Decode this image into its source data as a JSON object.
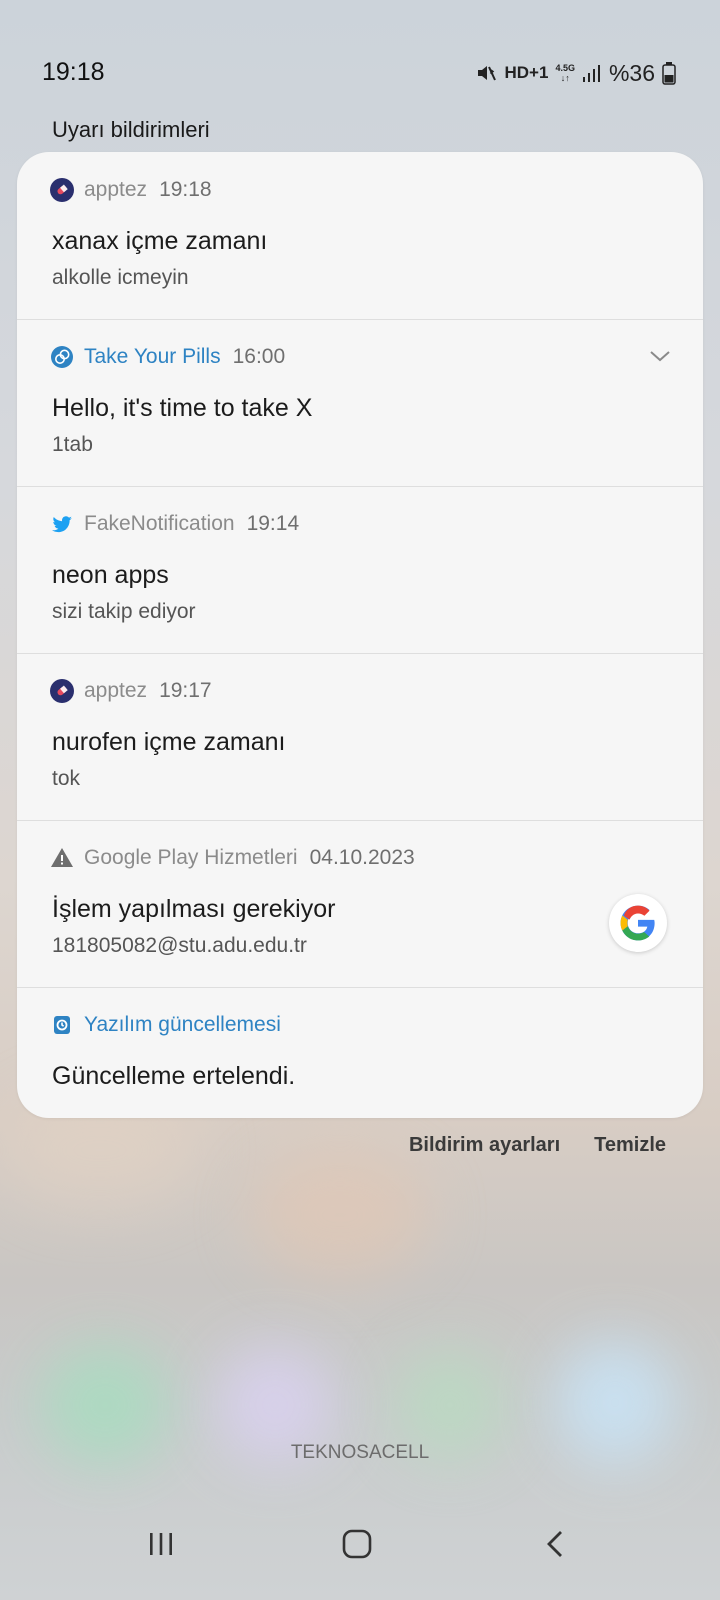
{
  "status_bar": {
    "time": "19:18",
    "network_label": "HD+1",
    "network_gen_top": "4.5G",
    "network_gen_bottom": "↓↑",
    "battery": "%36",
    "icons": [
      "mute-vibrate-icon",
      "signal-icon",
      "battery-icon"
    ]
  },
  "section_title": "Uyarı bildirimleri",
  "notifications": [
    {
      "app": "apptez",
      "time": "19:18",
      "title": "xanax içme zamanı",
      "body": "alkolle icmeyin",
      "icon": "apptez-icon"
    },
    {
      "app": "Take Your Pills",
      "time": "16:00",
      "title": "Hello, it's time to take X",
      "body": "1tab",
      "icon": "pill-icon",
      "accent": "#2e83c3"
    },
    {
      "app": "FakeNotification",
      "time": "19:14",
      "title": "neon apps",
      "body": "sizi takip ediyor",
      "icon": "twitter-bird-icon"
    },
    {
      "app": "apptez",
      "time": "19:17",
      "title": "nurofen içme zamanı",
      "body": "tok",
      "icon": "apptez-icon"
    },
    {
      "app": "Google Play Hizmetleri",
      "time": "04.10.2023",
      "title": "İşlem yapılması gerekiyor",
      "body": "181805082@stu.adu.edu.tr",
      "icon": "warning-icon"
    },
    {
      "app": "Yazılım güncellemesi",
      "time": "",
      "title": "Güncelleme ertelendi.",
      "body": "",
      "icon": "software-update-icon",
      "accent": "#2e83c3"
    }
  ],
  "actions": {
    "settings": "Bildirim ayarları",
    "clear": "Temizle"
  },
  "carrier": "TEKNOSACELL",
  "nav": [
    "recents-icon",
    "home-icon",
    "back-icon"
  ],
  "colors": {
    "panel": "#f6f6f6",
    "accent": "#2e83c3",
    "twitter": "#1da1f2"
  }
}
